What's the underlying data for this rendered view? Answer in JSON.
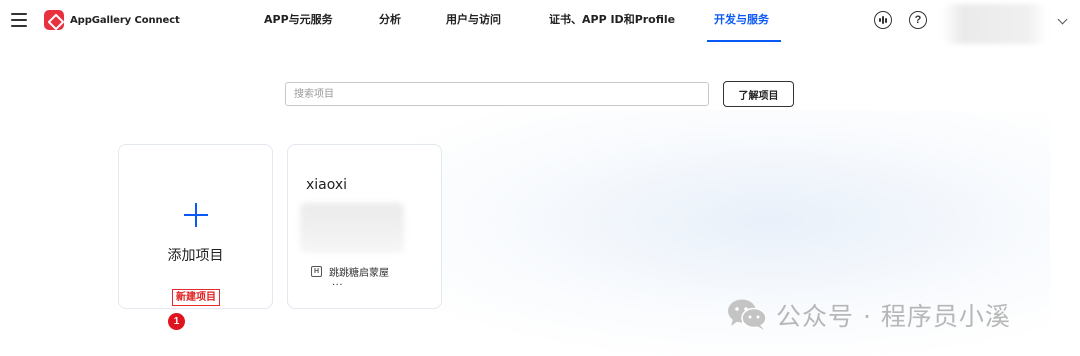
{
  "header": {
    "logo_text": "AppGallery Connect",
    "nav": [
      {
        "label": "APP与元服务",
        "active": false
      },
      {
        "label": "分析",
        "active": false
      },
      {
        "label": "用户与访问",
        "active": false
      },
      {
        "label": "证书、APP ID和Profile",
        "active": false
      },
      {
        "label": "开发与服务",
        "active": true
      }
    ],
    "help_glyph": "?"
  },
  "search": {
    "placeholder": "搜索项目",
    "value": "",
    "learn_button": "了解项目"
  },
  "cards": {
    "add": {
      "label": "添加项目",
      "tag": "新建项目",
      "badge": "1"
    },
    "project": {
      "name": "xiaoxi",
      "app_icon_letter": "H",
      "app_name": "跳跳糖启蒙屋",
      "more": "..."
    }
  },
  "watermark": {
    "text": "公众号 · 程序员小溪"
  },
  "colors": {
    "accent": "#0a59f7",
    "tag_red": "#e02020",
    "logo_red": "#e8303f"
  }
}
